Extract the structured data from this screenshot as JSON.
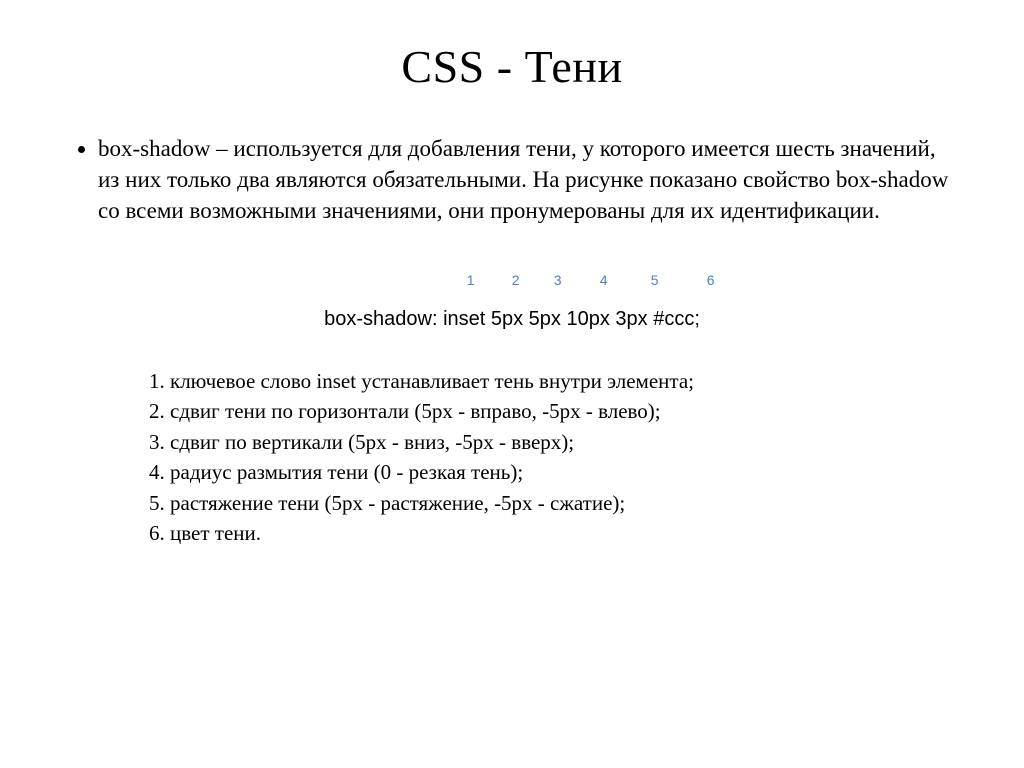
{
  "title": "CSS - Тени",
  "bullet": "box-shadow – используется для добавления тени, у которого имеется шесть значений, из них только два являются обязательными. На рисунке показано свойство box-shadow со всеми возможными значениями, они пронумерованы для их идентификации.",
  "numbers": [
    "1",
    "2",
    "3",
    "4",
    "5",
    "6"
  ],
  "code": "box-shadow: inset 5px 5px 10px 3px #ccc;",
  "legend": [
    "ключевое слово inset устанавливает тень внутри элемента;",
    "сдвиг тени по горизонтали (5px - вправо, -5px - влево);",
    "сдвиг по вертикали (5px - вниз, -5px - вверх);",
    "радиус размытия тени (0 - резкая тень);",
    "растяжение тени (5px - растяжение, -5px - сжатие);",
    "цвет тени."
  ]
}
